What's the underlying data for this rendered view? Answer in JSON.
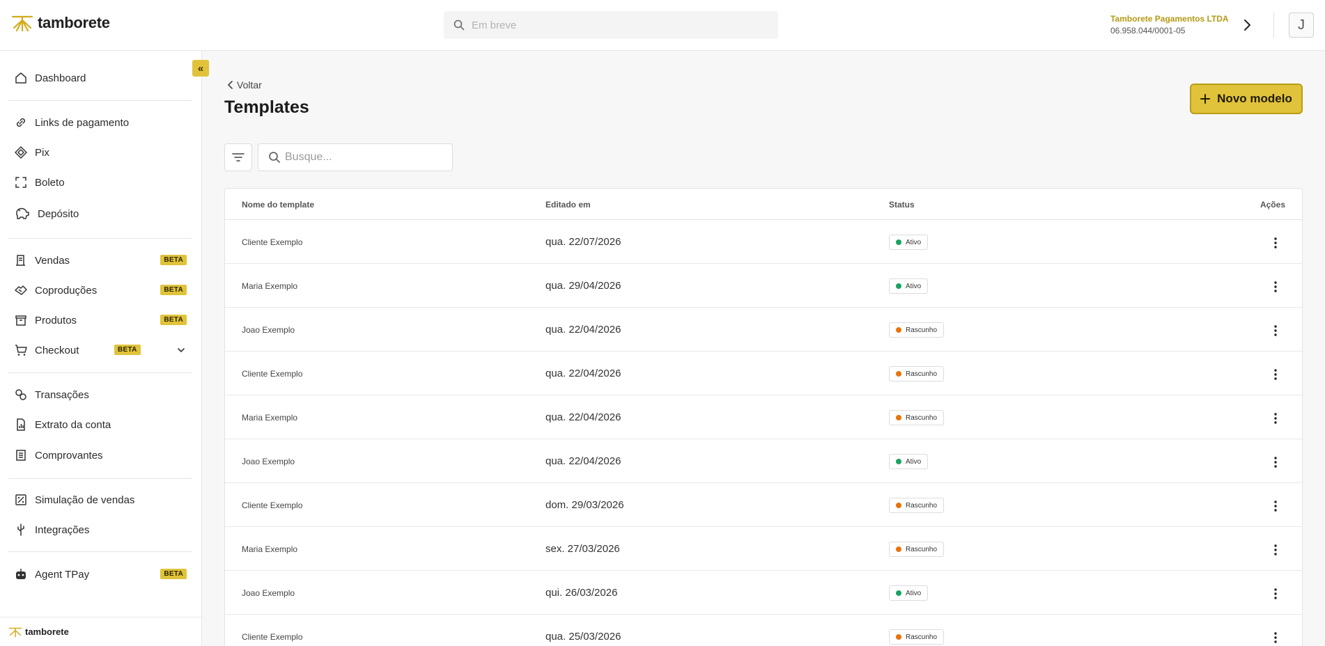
{
  "header": {
    "logo_text": "tamborete",
    "search_placeholder": "Em breve",
    "company_name": "Tamborete Pagamentos LTDA",
    "company_doc": "06.958.044/0001-05",
    "avatar_initial": "J"
  },
  "sidebar": {
    "collapse_label": "«",
    "items": [
      {
        "label": "Dashboard"
      },
      {
        "label": "Links de pagamento"
      },
      {
        "label": "Pix"
      },
      {
        "label": "Boleto"
      },
      {
        "label": "Depósito"
      },
      {
        "label": "Vendas",
        "badge": "BETA"
      },
      {
        "label": "Coproduções",
        "badge": "BETA"
      },
      {
        "label": "Produtos",
        "badge": "BETA"
      },
      {
        "label": "Checkout",
        "badge": "BETA"
      },
      {
        "label": "Transações"
      },
      {
        "label": "Extrato da conta"
      },
      {
        "label": "Comprovantes"
      },
      {
        "label": "Simulação de vendas"
      },
      {
        "label": "Integrações"
      },
      {
        "label": "Agent TPay",
        "badge": "BETA"
      }
    ],
    "footer_logo_text": "tamborete"
  },
  "main": {
    "back_label": "Voltar",
    "title": "Templates",
    "new_button_label": "Novo modelo",
    "search_placeholder": "Busque...",
    "columns": {
      "name": "Nome do template",
      "edited": "Editado em",
      "status": "Status",
      "actions": "Ações"
    },
    "rows": [
      {
        "name": "Cliente Exemplo",
        "edited": "qua. 22/07/2026",
        "status": "Ativo"
      },
      {
        "name": "Maria Exemplo",
        "edited": "qua. 29/04/2026",
        "status": "Ativo"
      },
      {
        "name": "Joao Exemplo",
        "edited": "qua. 22/04/2026",
        "status": "Rascunho"
      },
      {
        "name": "Cliente Exemplo",
        "edited": "qua. 22/04/2026",
        "status": "Rascunho"
      },
      {
        "name": "Maria Exemplo",
        "edited": "qua. 22/04/2026",
        "status": "Rascunho"
      },
      {
        "name": "Joao Exemplo",
        "edited": "qua. 22/04/2026",
        "status": "Ativo"
      },
      {
        "name": "Cliente Exemplo",
        "edited": "dom. 29/03/2026",
        "status": "Rascunho"
      },
      {
        "name": "Maria Exemplo",
        "edited": "sex. 27/03/2026",
        "status": "Rascunho"
      },
      {
        "name": "Joao Exemplo",
        "edited": "qui. 26/03/2026",
        "status": "Ativo"
      },
      {
        "name": "Cliente Exemplo",
        "edited": "qua. 25/03/2026",
        "status": "Rascunho"
      }
    ]
  },
  "colors": {
    "accent": "#e0c33a",
    "status_active": "#1aa260",
    "status_draft": "#e8740c"
  }
}
